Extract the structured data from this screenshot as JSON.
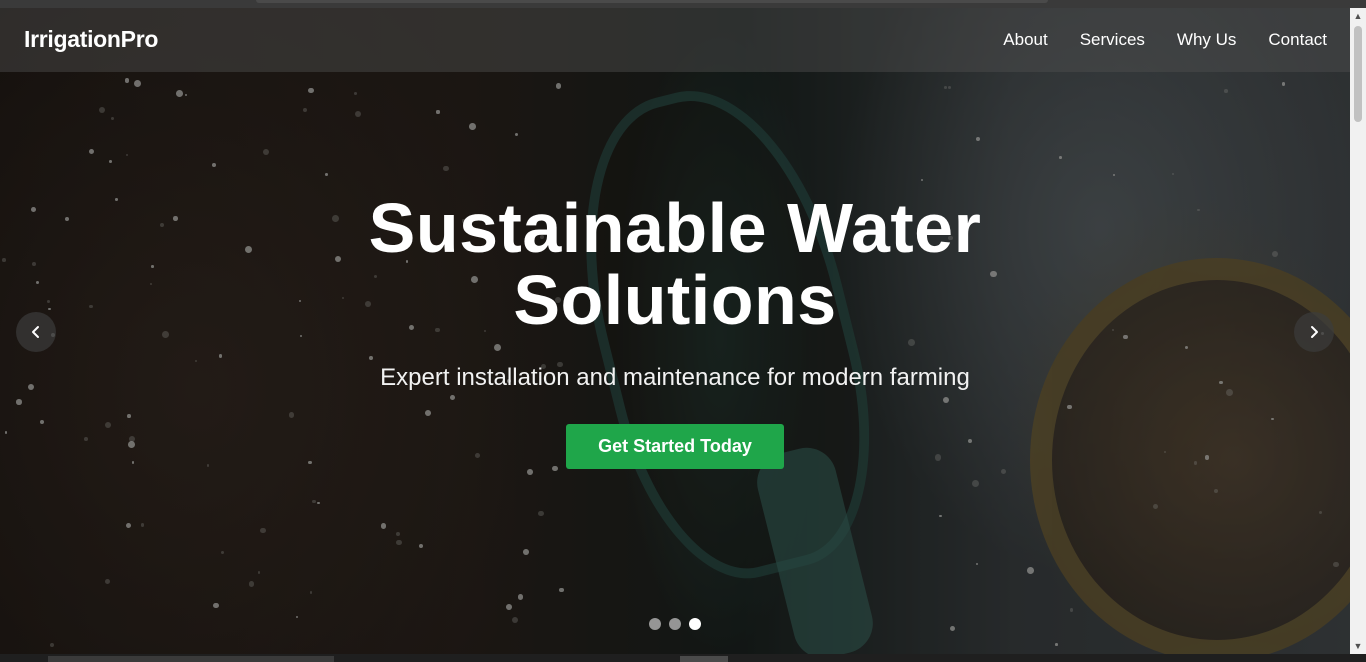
{
  "navbar": {
    "brand": "IrrigationPro",
    "links": [
      {
        "label": "About"
      },
      {
        "label": "Services"
      },
      {
        "label": "Why Us"
      },
      {
        "label": "Contact"
      }
    ]
  },
  "hero": {
    "title": "Sustainable Water Solutions",
    "subtitle": "Expert installation and maintenance for modern farming",
    "cta_label": "Get Started Today",
    "prev_icon": "chevron-left-icon",
    "next_icon": "chevron-right-icon",
    "slides_total": 3,
    "active_slide": 3
  },
  "colors": {
    "cta": "#1fa64a",
    "text": "#ffffff"
  }
}
